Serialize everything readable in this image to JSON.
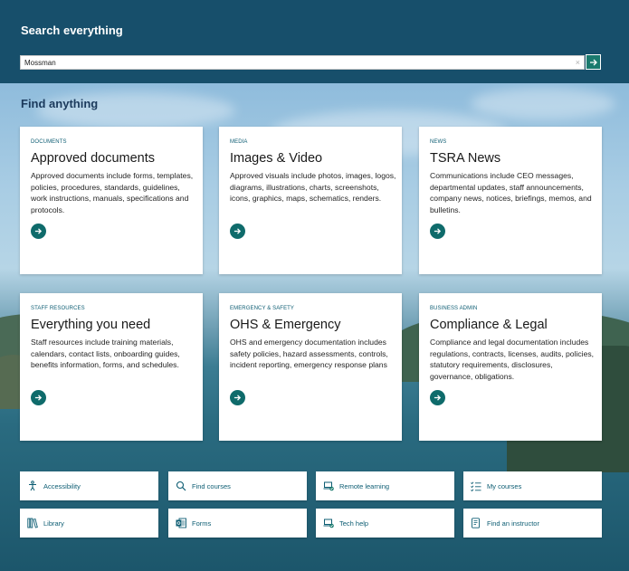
{
  "header": {
    "title": "Search everything",
    "search_value": "Mossman",
    "clear_glyph": "×"
  },
  "section": {
    "title": "Find anything"
  },
  "cards": [
    {
      "category": "DOCUMENTS",
      "title": "Approved documents",
      "description": "Approved documents include forms, templates, policies, procedures, standards, guidelines, work instructions, manuals, specifications and protocols."
    },
    {
      "category": "MEDIA",
      "title": "Images & Video",
      "description": "Approved visuals include photos, images, logos, diagrams, illustrations, charts, screenshots, icons, graphics, maps, schematics, renders."
    },
    {
      "category": "NEWS",
      "title": "TSRA News",
      "description": "Communications include CEO messages, departmental updates, staff announcements, company news, notices, briefings, memos, and bulletins."
    },
    {
      "category": "STAFF RESOURCES",
      "title": "Everything you need",
      "description": "Staff resources include training materials, calendars, contact lists, onboarding guides, benefits information, forms, and schedules."
    },
    {
      "category": "EMERGENCY & SAFETY",
      "title": "OHS & Emergency",
      "description": "OHS and emergency documentation includes safety policies, hazard assessments, controls, incident reporting, emergency response plans"
    },
    {
      "category": "BUSINESS ADMIN",
      "title": "Compliance & Legal",
      "description": "Compliance and legal documentation includes regulations, contracts, licenses, audits, policies, statutory requirements, disclosures, governance, obligations."
    }
  ],
  "quick_links": [
    {
      "label": "Accessibility",
      "icon": "accessibility-icon"
    },
    {
      "label": "Find courses",
      "icon": "search-icon"
    },
    {
      "label": "Remote learning",
      "icon": "laptop-check-icon"
    },
    {
      "label": "My courses",
      "icon": "checklist-icon"
    },
    {
      "label": "Library",
      "icon": "books-icon"
    },
    {
      "label": "Forms",
      "icon": "forms-icon"
    },
    {
      "label": "Tech help",
      "icon": "laptop-help-icon"
    },
    {
      "label": "Find an instructor",
      "icon": "document-person-icon"
    }
  ],
  "colors": {
    "header_bg": "#174f6b",
    "accent": "#0f6b6b",
    "category_text": "#0d5d73",
    "section_title": "#1b3a5c"
  }
}
